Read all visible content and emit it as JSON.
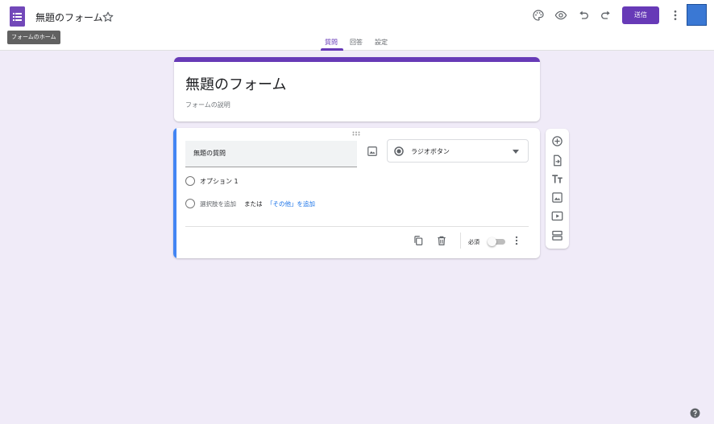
{
  "header": {
    "app_icon": "forms-app-icon",
    "doc_title": "無題のフォーム",
    "tooltip": "フォームのホーム",
    "send_label": "送信",
    "icons": [
      "palette-icon",
      "eye-icon",
      "undo-icon",
      "redo-icon",
      "more-vert-icon"
    ],
    "accent": "#673ab7"
  },
  "tabs": [
    {
      "label": "質問",
      "active": true
    },
    {
      "label": "回答",
      "active": false
    },
    {
      "label": "設定",
      "active": false
    }
  ],
  "form": {
    "title": "無題のフォーム",
    "description_placeholder": "フォームの説明"
  },
  "question": {
    "title": "無題の質問",
    "type": "ラジオボタン",
    "options": [
      "オプション 1"
    ],
    "add_option": "選択肢を追加",
    "or_text": "または",
    "add_other": "「その他」を追加",
    "required_label": "必須",
    "required": false,
    "accent": "#4285f4"
  },
  "toolbar": {
    "icons": [
      "add-question-icon",
      "import-questions-icon",
      "add-title-icon",
      "add-image-icon",
      "add-video-icon",
      "add-section-icon"
    ]
  },
  "colors": {
    "background": "#f0ebf8",
    "primary": "#673ab7",
    "link": "#1a73e8"
  }
}
